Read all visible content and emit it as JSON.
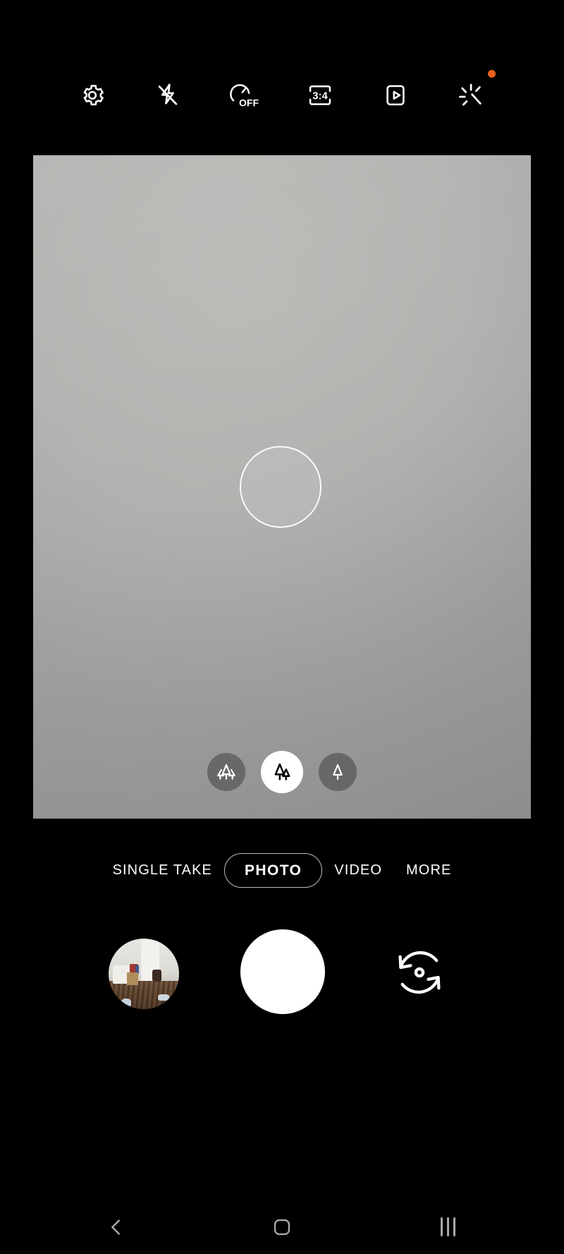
{
  "app": {
    "name": "Camera",
    "preview_bg": "#aeaeac",
    "panel_bg": "#000000"
  },
  "top_toolbar": {
    "items": [
      {
        "icon": "settings-gear-icon",
        "label": "Settings",
        "state": ""
      },
      {
        "icon": "flash-off-icon",
        "label": "Flash",
        "state": "off"
      },
      {
        "icon": "timer-off-icon",
        "label": "Timer",
        "state": "OFF"
      },
      {
        "icon": "aspect-ratio-icon",
        "label": "Aspect ratio",
        "state": "3:4"
      },
      {
        "icon": "motion-photo-icon",
        "label": "Motion photo",
        "state": ""
      },
      {
        "icon": "magic-wand-filters-icon",
        "label": "Filters and effects",
        "state": "",
        "badge": true
      }
    ],
    "timer_text": "OFF",
    "aspect_text": "3:4",
    "badge_color": "#e8601c",
    "icon_color": "#ffffff"
  },
  "viewfinder": {
    "focus_indicator": "focus-ring",
    "lens_selector": {
      "options": [
        {
          "id": "ultra-wide",
          "icon": "three-trees-icon",
          "selected": false
        },
        {
          "id": "wide",
          "icon": "two-trees-icon",
          "selected": true
        },
        {
          "id": "telephoto",
          "icon": "one-tree-icon",
          "selected": false
        }
      ]
    }
  },
  "modes": {
    "items": [
      {
        "label": "SINGLE TAKE",
        "selected": false
      },
      {
        "label": "PHOTO",
        "selected": true
      },
      {
        "label": "VIDEO",
        "selected": false
      },
      {
        "label": "MORE",
        "selected": false
      }
    ]
  },
  "actions": {
    "gallery_label": "Gallery",
    "shutter_label": "Take picture",
    "flip_label": "Switch camera"
  },
  "nav_bar": {
    "back_label": "Back",
    "home_label": "Home",
    "recents_label": "Recents",
    "icon_color": "#a8a8a8"
  }
}
